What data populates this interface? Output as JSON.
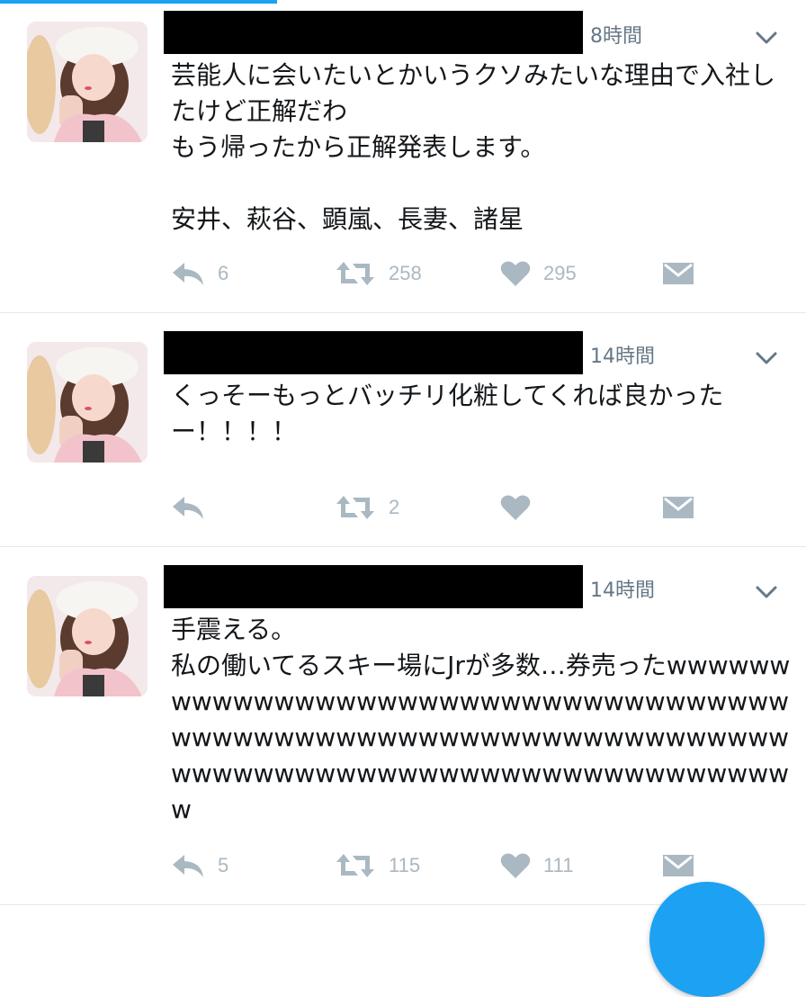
{
  "colors": {
    "accent": "#1da1f2",
    "text": "#14171a",
    "muted": "#657786",
    "icon": "#aab8c2",
    "divider": "#e1e8ed",
    "redaction": "#000000"
  },
  "tweets": [
    {
      "time": "8時間",
      "text": "芸能人に会いたいとかいうクソみたいな理由で入社したけど正解だわ\nもう帰ったから正解発表します。\n\n安井、萩谷、顕嵐、長妻、諸星",
      "reply_count": "6",
      "retweet_count": "258",
      "like_count": "295"
    },
    {
      "time": "14時間",
      "text": "くっそーもっとバッチリ化粧してくれば良かったー！！！！",
      "reply_count": "",
      "retweet_count": "2",
      "like_count": ""
    },
    {
      "time": "14時間",
      "text": "手震える。\n私の働いてるスキー場にJrが多数…券売ったwwwwwwwwwwwwwwwwwwwwwwwwwwwwwwwwwwwwwwwwwwwwwwwwwwwwwwwwwwwwwwwwwwwwwwwwwwwwwwwwwwwwwwwwwwwwwwwww",
      "reply_count": "5",
      "retweet_count": "115",
      "like_count": "111"
    }
  ],
  "icons": {
    "reply": "reply-icon",
    "retweet": "retweet-icon",
    "like": "heart-icon",
    "dm": "direct-message-icon",
    "caret": "chevron-down-icon",
    "compose": "compose-fab"
  }
}
